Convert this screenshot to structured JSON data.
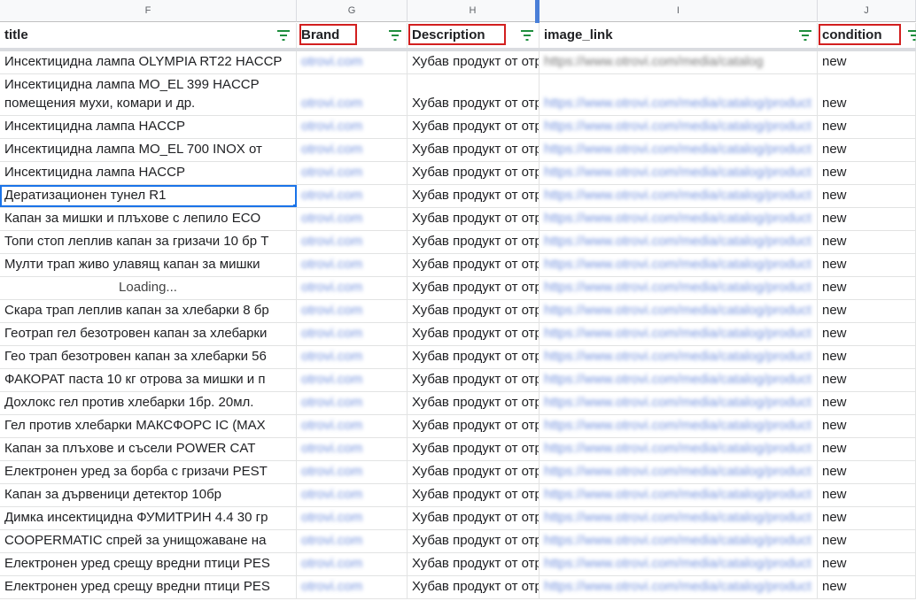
{
  "columns": {
    "letters": [
      "F",
      "G",
      "H",
      "I",
      "J"
    ],
    "headers": [
      "title",
      "Brand",
      "Description",
      "image_link",
      "condition"
    ]
  },
  "colors": {
    "highlight_box": "#d21f1f",
    "filter_icon": "#1e8e3e",
    "selection": "#1a73e8",
    "freeze_bar": "#4a7fd8",
    "blurred_link": "#5b7fd9"
  },
  "selected_row": 5,
  "rows": [
    {
      "title": "Инсектицидна лампа OLYMPIA RT22 HACCP",
      "brand": "otrovi.com",
      "description": "Хубав продукт от отрови",
      "image_link": "https://www.otrovi.com/media/catalog",
      "condition": "new"
    },
    {
      "title": "Инсектицидна лампа MO_EL 399 HACCP",
      "title2": "помещения мухи, комари и др.",
      "brand": "otrovi.com",
      "description": "Хубав продукт от отрови",
      "image_link": "https://www.otrovi.com/media/catalog/product",
      "condition": "new"
    },
    {
      "title": "Инсектицидна лампа HACCP",
      "brand": "otrovi.com",
      "description": "Хубав продукт от отрови",
      "image_link": "https://www.otrovi.com/media/catalog/product",
      "condition": "new"
    },
    {
      "title": "Инсектицидна лампа MO_EL 700 INOX от",
      "brand": "otrovi.com",
      "description": "Хубав продукт от отрови",
      "image_link": "https://www.otrovi.com/media/catalog/product",
      "condition": "new"
    },
    {
      "title": "Инсектицидна лампа HACCP",
      "brand": "otrovi.com",
      "description": "Хубав продукт от отрови",
      "image_link": "https://www.otrovi.com/media/catalog/product",
      "condition": "new"
    },
    {
      "title": "Дератизационен тунел R1",
      "brand": "otrovi.com",
      "description": "Хубав продукт от отрови",
      "image_link": "https://www.otrovi.com/media/catalog/product",
      "condition": "new"
    },
    {
      "title": "Капан за мишки и плъхове с лепило ECO",
      "brand": "otrovi.com",
      "description": "Хубав продукт от отрови",
      "image_link": "https://www.otrovi.com/media/catalog/product",
      "condition": "new"
    },
    {
      "title": "Топи стоп леплив капан за гризачи 10 бр T",
      "brand": "otrovi.com",
      "description": "Хубав продукт от отрови",
      "image_link": "https://www.otrovi.com/media/catalog/product",
      "condition": "new"
    },
    {
      "title": "Мулти трап живо улавящ капан за мишки",
      "brand": "otrovi.com",
      "description": "Хубав продукт от отрови",
      "image_link": "https://www.otrovi.com/media/catalog/product",
      "condition": "new"
    },
    {
      "title": "",
      "loading": "Loading...",
      "brand": "otrovi.com",
      "description": "Хубав продукт от отрови",
      "image_link": "https://www.otrovi.com/media/catalog/product",
      "condition": "new"
    },
    {
      "title": "Скара трап леплив капан за хлебарки 8 бр",
      "brand": "otrovi.com",
      "description": "Хубав продукт от отрови",
      "image_link": "https://www.otrovi.com/media/catalog/product",
      "condition": "new"
    },
    {
      "title": "Геотрап гел безотровен капан за хлебарки",
      "brand": "otrovi.com",
      "description": "Хубав продукт от отрови",
      "image_link": "https://www.otrovi.com/media/catalog/product",
      "condition": "new"
    },
    {
      "title": "Гео трап безотровен капан за хлебарки 56",
      "brand": "otrovi.com",
      "description": "Хубав продукт от отрови",
      "image_link": "https://www.otrovi.com/media/catalog/product",
      "condition": "new"
    },
    {
      "title": "ФАКОРАТ паста 10 кг отрова за мишки и п",
      "brand": "otrovi.com",
      "description": "Хубав продукт от отрови",
      "image_link": "https://www.otrovi.com/media/catalog/product",
      "condition": "new"
    },
    {
      "title": "Дохлокс гел против хлебарки 1бр. 20мл.",
      "brand": "otrovi.com",
      "description": "Хубав продукт от отрови",
      "image_link": "https://www.otrovi.com/media/catalog/product",
      "condition": "new"
    },
    {
      "title": "Гел против хлебарки МАКСФОРС IC (MAX",
      "brand": "otrovi.com",
      "description": "Хубав продукт от отрови",
      "image_link": "https://www.otrovi.com/media/catalog/product",
      "condition": "new"
    },
    {
      "title": "Капан за плъхове и съсели POWER CAT",
      "brand": "otrovi.com",
      "description": "Хубав продукт от отрови",
      "image_link": "https://www.otrovi.com/media/catalog/product",
      "condition": "new"
    },
    {
      "title": "Електронен уред за борба с гризачи PEST",
      "brand": "otrovi.com",
      "description": "Хубав продукт от отрови",
      "image_link": "https://www.otrovi.com/media/catalog/product",
      "condition": "new"
    },
    {
      "title": "Капан за дървеници детектор 10бр",
      "brand": "otrovi.com",
      "description": "Хубав продукт от отрови",
      "image_link": "https://www.otrovi.com/media/catalog/product",
      "condition": "new"
    },
    {
      "title": "Димка инсектицидна ФУМИТРИН 4.4 30 гр",
      "brand": "otrovi.com",
      "description": "Хубав продукт от отрови",
      "image_link": "https://www.otrovi.com/media/catalog/product",
      "condition": "new"
    },
    {
      "title": "COOPERMATIC спрей за унищожаване на",
      "brand": "otrovi.com",
      "description": "Хубав продукт от отрови",
      "image_link": "https://www.otrovi.com/media/catalog/product",
      "condition": "new"
    },
    {
      "title": "Електронен уред срещу вредни птици PES",
      "brand": "otrovi.com",
      "description": "Хубав продукт от отрови",
      "image_link": "https://www.otrovi.com/media/catalog/product",
      "condition": "new"
    },
    {
      "title": "Електронен уред срещу вредни птици PES",
      "brand": "otrovi.com",
      "description": "Хубав продукт от отрови",
      "image_link": "https://www.otrovi.com/media/catalog/product",
      "condition": "new"
    }
  ]
}
